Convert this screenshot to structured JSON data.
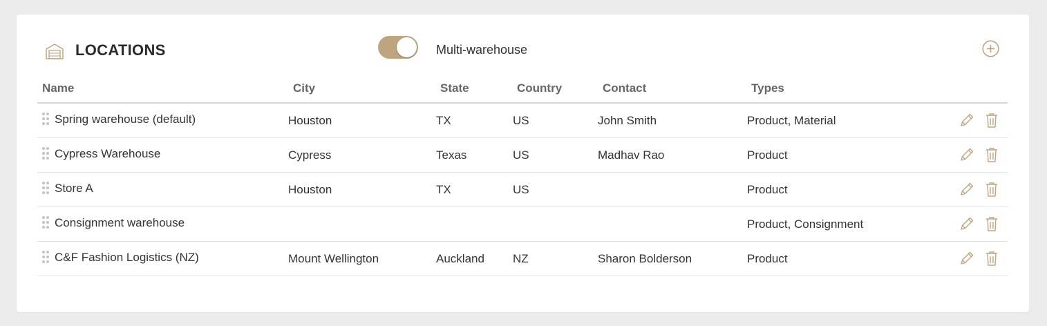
{
  "header": {
    "title": "LOCATIONS",
    "toggle_label": "Multi-warehouse",
    "toggle_on": true,
    "icon": "warehouse-icon",
    "add_icon": "plus-circle-icon"
  },
  "colors": {
    "accent": "#bfa57d",
    "background": "#ececec",
    "card": "#ffffff"
  },
  "columns": {
    "name": "Name",
    "city": "City",
    "state": "State",
    "country": "Country",
    "contact": "Contact",
    "types": "Types"
  },
  "rows": [
    {
      "name": "Spring warehouse (default)",
      "city": "Houston",
      "state": "TX",
      "country": "US",
      "contact": "John Smith",
      "types": "Product, Material"
    },
    {
      "name": "Cypress Warehouse",
      "city": "Cypress",
      "state": "Texas",
      "country": "US",
      "contact": "Madhav Rao",
      "types": "Product"
    },
    {
      "name": "Store A",
      "city": "Houston",
      "state": "TX",
      "country": "US",
      "contact": "",
      "types": "Product"
    },
    {
      "name": "Consignment warehouse",
      "city": "",
      "state": "",
      "country": "",
      "contact": "",
      "types": "Product, Consignment"
    },
    {
      "name": "C&F Fashion Logistics (NZ)",
      "city": "Mount Wellington",
      "state": "Auckland",
      "country": "NZ",
      "contact": "Sharon Bolderson",
      "types": "Product"
    }
  ]
}
